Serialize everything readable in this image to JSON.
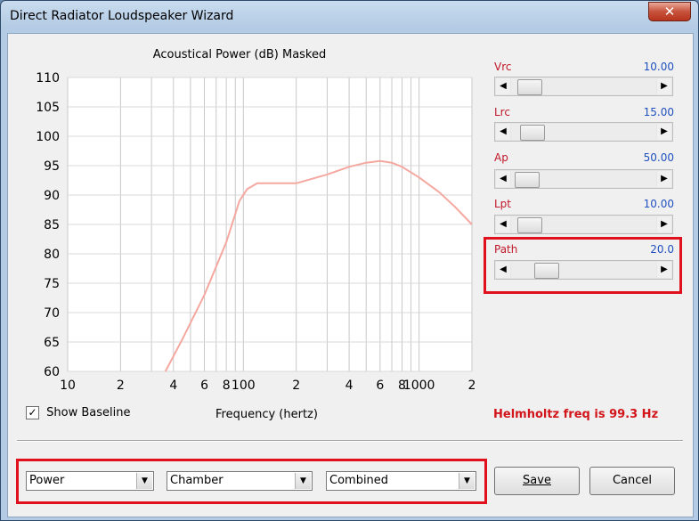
{
  "window": {
    "title": "Direct Radiator Loudspeaker Wizard",
    "close_glyph": "✕"
  },
  "chart_data": {
    "type": "line",
    "title": "Acoustical Power (dB)   Masked",
    "xlabel": "Frequency (hertz)",
    "ylabel": "",
    "x_scale": "log",
    "xlim": [
      10,
      2000
    ],
    "ylim": [
      60,
      110
    ],
    "y_ticks": [
      "110",
      "105",
      "100",
      "95",
      "90",
      "85",
      "80",
      "75",
      "70",
      "65",
      "60"
    ],
    "x_ticks": [
      "10",
      "2",
      "4",
      "6",
      "8",
      "100",
      "2",
      "4",
      "6",
      "8",
      "1000",
      "2"
    ],
    "grid": true,
    "series": [
      {
        "color": "#f5a8a0",
        "x": [
          36,
          45,
          60,
          80,
          95,
          105,
          120,
          150,
          200,
          300,
          400,
          500,
          600,
          700,
          800,
          1000,
          1300,
          1600,
          2000
        ],
        "y": [
          60,
          65.5,
          73,
          82,
          89,
          91,
          92,
          92,
          92,
          93.5,
          94.8,
          95.5,
          95.8,
          95.5,
          94.8,
          93,
          90.5,
          88,
          85
        ]
      }
    ]
  },
  "show_baseline": {
    "label": "Show Baseline",
    "checked_glyph": "✓",
    "checked": true
  },
  "helmholtz": "Helmholtz freq is 99.3 Hz",
  "sliders": [
    {
      "label": "Vrc",
      "value": "10.00",
      "position": 0.05
    },
    {
      "label": "Lrc",
      "value": "15.00",
      "position": 0.07
    },
    {
      "label": "Ap",
      "value": "50.00",
      "position": 0.03
    },
    {
      "label": "Lpt",
      "value": "10.00",
      "position": 0.05
    },
    {
      "label": "Path",
      "value": "20.0",
      "position": 0.19
    }
  ],
  "combos": [
    {
      "label": "Power",
      "arrow": "▼"
    },
    {
      "label": "Chamber",
      "arrow": "▼"
    },
    {
      "label": "Combined",
      "arrow": "▼"
    }
  ],
  "buttons": {
    "save": "Save",
    "cancel": "Cancel"
  },
  "slider_arrows": {
    "left": "◀",
    "right": "▶"
  }
}
